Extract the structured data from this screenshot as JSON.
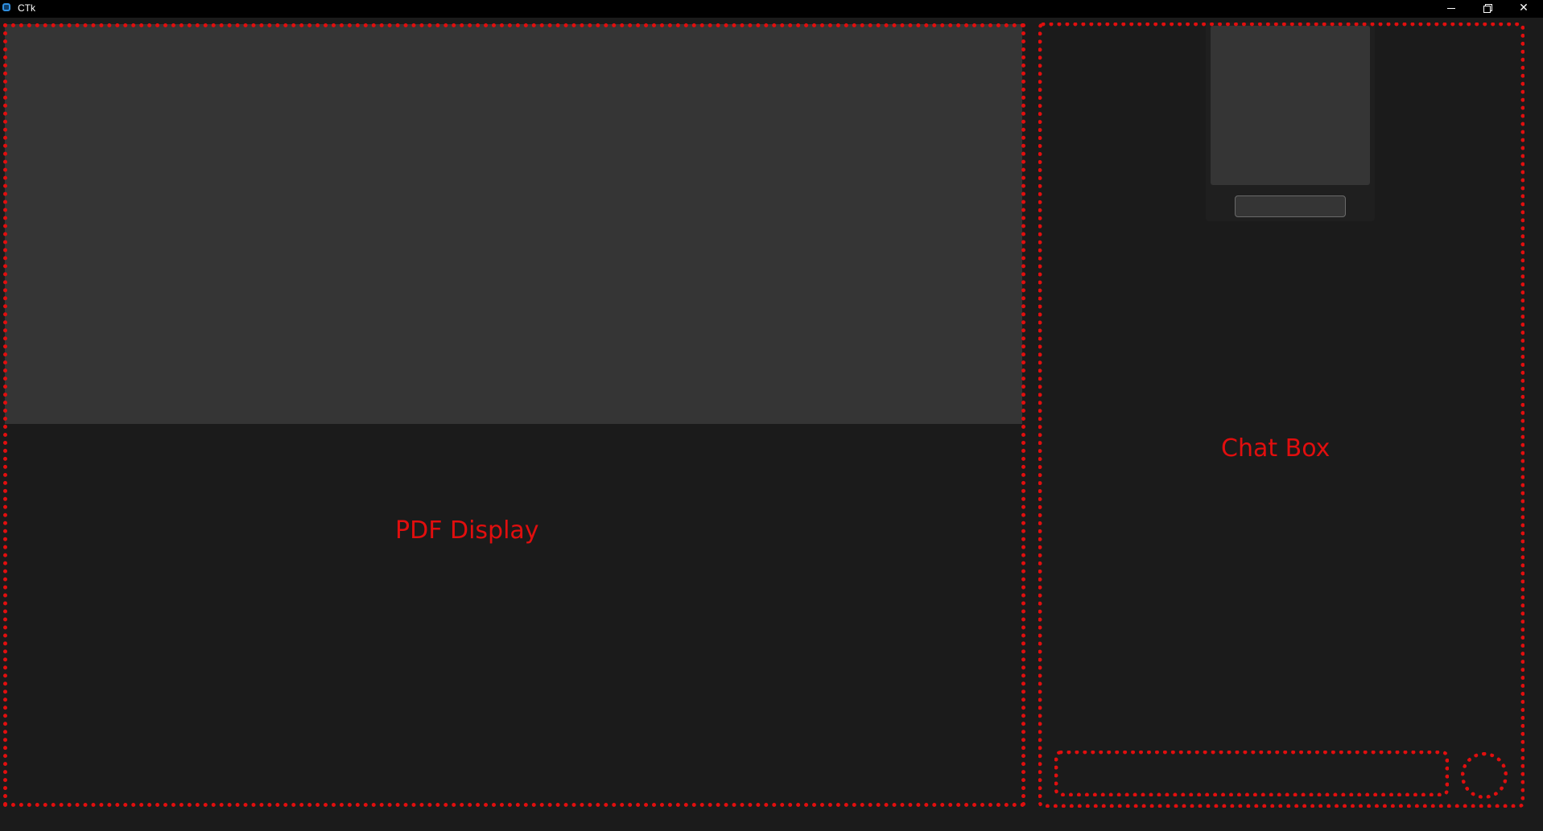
{
  "window": {
    "title": "CTk",
    "icon": "ctk-app-icon",
    "controls": {
      "minimize_icon": "minimize-icon",
      "maximize_icon": "restore-icon",
      "close_label": "✕"
    }
  },
  "colors": {
    "annotation": "#e10e0e",
    "background": "#1b1b1b",
    "panel": "#353535",
    "titlebar": "#000000"
  },
  "pdf_display": {
    "label": "PDF Display"
  },
  "chat_box": {
    "label": "Chat Box",
    "message_input": {
      "value": "",
      "placeholder": ""
    },
    "card_input": {
      "value": ""
    }
  }
}
